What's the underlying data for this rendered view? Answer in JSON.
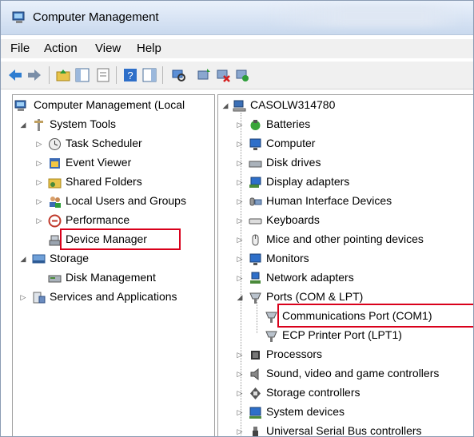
{
  "window": {
    "title": "Computer Management"
  },
  "menu": [
    "File",
    "Action",
    "View",
    "Help"
  ],
  "toolbar_icons": [
    "back-arrow-icon",
    "forward-arrow-icon",
    "up-folder-icon",
    "show-hide-tree-icon",
    "properties-icon",
    "help-icon",
    "show-hide-action-pane-icon",
    "scan-hardware-icon",
    "update-driver-icon",
    "uninstall-device-icon",
    "disable-device-icon"
  ],
  "left_tree": [
    {
      "label": "Computer Management (Local",
      "level": 0,
      "icon": "computer-management-icon"
    },
    {
      "label": "System Tools",
      "level": 1,
      "icon": "tools-icon",
      "expanded": true
    },
    {
      "label": "Task Scheduler",
      "level": 2,
      "icon": "clock-icon"
    },
    {
      "label": "Event Viewer",
      "level": 2,
      "icon": "event-viewer-icon"
    },
    {
      "label": "Shared Folders",
      "level": 2,
      "icon": "shared-folder-icon"
    },
    {
      "label": "Local Users and Groups",
      "level": 2,
      "icon": "users-icon"
    },
    {
      "label": "Performance",
      "level": 2,
      "icon": "performance-icon"
    },
    {
      "label": "Device Manager",
      "level": 2,
      "icon": "device-manager-icon",
      "highlighted": true
    },
    {
      "label": "Storage",
      "level": 1,
      "icon": "storage-icon",
      "expanded": true
    },
    {
      "label": "Disk Management",
      "level": 2,
      "icon": "disk-icon"
    },
    {
      "label": "Services and Applications",
      "level": 1,
      "icon": "services-icon"
    }
  ],
  "right_tree": [
    {
      "label": "CASOLW314780",
      "level": 0,
      "icon": "computer-icon",
      "expanded": true
    },
    {
      "label": "Batteries",
      "level": 1,
      "icon": "battery-icon"
    },
    {
      "label": "Computer",
      "level": 1,
      "icon": "monitor-icon"
    },
    {
      "label": "Disk drives",
      "level": 1,
      "icon": "disk-drive-icon"
    },
    {
      "label": "Display adapters",
      "level": 1,
      "icon": "display-adapter-icon"
    },
    {
      "label": "Human Interface Devices",
      "level": 1,
      "icon": "hid-icon"
    },
    {
      "label": "Keyboards",
      "level": 1,
      "icon": "keyboard-icon"
    },
    {
      "label": "Mice and other pointing devices",
      "level": 1,
      "icon": "mouse-icon"
    },
    {
      "label": "Monitors",
      "level": 1,
      "icon": "monitor-icon"
    },
    {
      "label": "Network adapters",
      "level": 1,
      "icon": "network-icon"
    },
    {
      "label": "Ports (COM & LPT)",
      "level": 1,
      "icon": "port-icon",
      "expanded": true
    },
    {
      "label": "Communications Port (COM1)",
      "level": 2,
      "icon": "port-icon",
      "highlighted": true
    },
    {
      "label": "ECP Printer Port (LPT1)",
      "level": 2,
      "icon": "port-icon"
    },
    {
      "label": "Processors",
      "level": 1,
      "icon": "processor-icon"
    },
    {
      "label": "Sound, video and game controllers",
      "level": 1,
      "icon": "sound-icon"
    },
    {
      "label": "Storage controllers",
      "level": 1,
      "icon": "storage-controller-icon"
    },
    {
      "label": "System devices",
      "level": 1,
      "icon": "system-devices-icon"
    },
    {
      "label": "Universal Serial Bus controllers",
      "level": 1,
      "icon": "usb-icon"
    }
  ],
  "colors": {
    "highlight": "#d9001b"
  }
}
